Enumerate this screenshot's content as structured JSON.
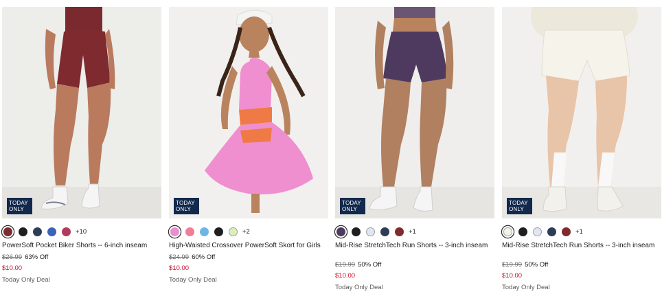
{
  "colors": {
    "sale_price": "#c8102e",
    "badge_bg": "#12284c"
  },
  "products": [
    {
      "badge": "TODAY\nONLY",
      "image_icon": "product-photo-biker-shorts",
      "swatches": [
        "#7e2a2f",
        "#1f1f1f",
        "#2c3d55",
        "#3a64b8",
        "#b23a5e"
      ],
      "more_colors": "+10",
      "title": "PowerSoft Pocket Biker Shorts -- 6-inch inseam",
      "original_price": "$26.99",
      "discount": "63% Off",
      "sale_price": "$10.00",
      "deal_label": "Today Only Deal"
    },
    {
      "badge": "TODAY\nONLY",
      "image_icon": "product-photo-skort",
      "swatches": [
        "#e88fcf",
        "#f17e97",
        "#6fb6e6",
        "#1f1f1f",
        "#dfeeb8"
      ],
      "more_colors": "+2",
      "title": "High-Waisted Crossover PowerSoft Skort for Girls",
      "original_price": "$24.99",
      "discount": "60% Off",
      "sale_price": "$10.00",
      "deal_label": "Today Only Deal"
    },
    {
      "badge": "TODAY\nONLY",
      "image_icon": "product-photo-run-shorts-purple",
      "swatches": [
        "#4e3a5e",
        "#1f1f1f",
        "#e2e6f0",
        "#2c3d55",
        "#7e2a2f"
      ],
      "more_colors": "+1",
      "title": "Mid-Rise StretchTech Run Shorts -- 3-inch inseam",
      "original_price": "$19.99",
      "discount": "50% Off",
      "sale_price": "$10.00",
      "deal_label": "Today Only Deal"
    },
    {
      "badge": "TODAY\nONLY",
      "image_icon": "product-photo-run-shorts-white",
      "swatches": [
        "#f4f1e8",
        "#1f1f1f",
        "#e2e6f0",
        "#2c3d55",
        "#7e2a2f"
      ],
      "more_colors": "+1",
      "title": "Mid-Rise StretchTech Run Shorts -- 3-inch inseam",
      "original_price": "$19.99",
      "discount": "50% Off",
      "sale_price": "$10.00",
      "deal_label": "Today Only Deal"
    }
  ]
}
